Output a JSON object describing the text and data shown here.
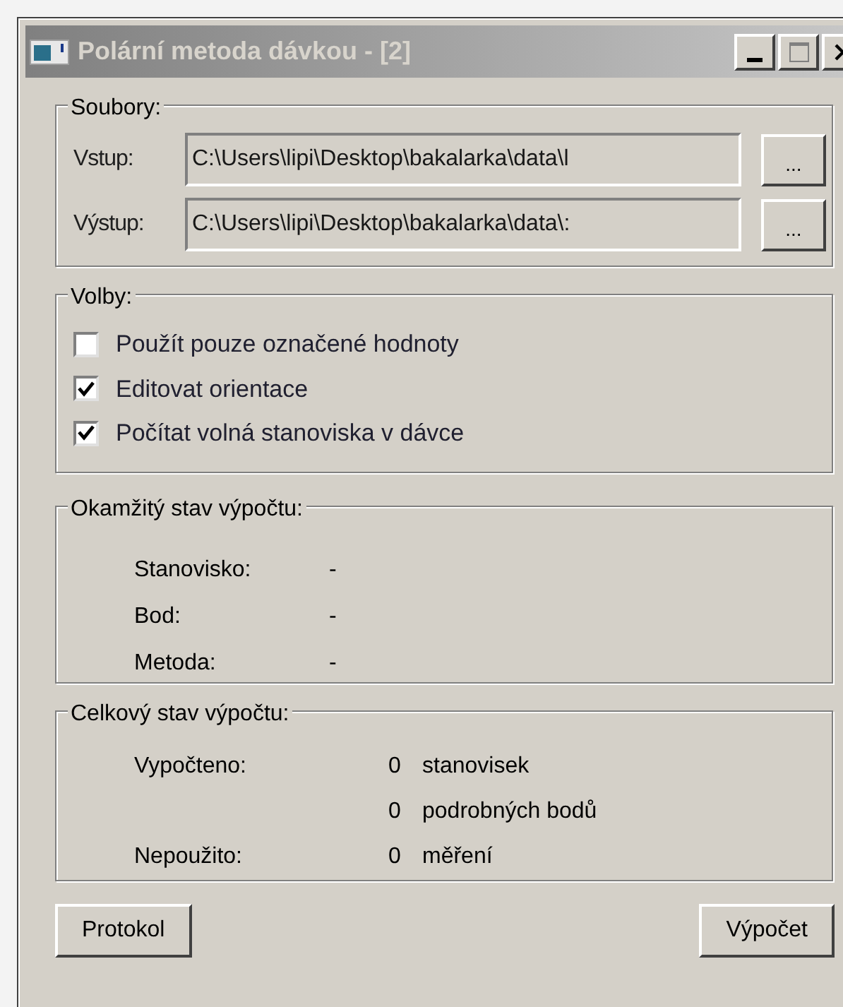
{
  "window": {
    "title": "Polární metoda dávkou - [2]"
  },
  "files": {
    "title": "Soubory:",
    "rows": [
      {
        "label": "Vstup:",
        "value": "C:\\Users\\lipi\\Desktop\\bakalarka\\data\\l",
        "browse": "..."
      },
      {
        "label": "Výstup:",
        "value": "C:\\Users\\lipi\\Desktop\\bakalarka\\data\\:",
        "browse": "..."
      }
    ]
  },
  "options": {
    "title": "Volby:",
    "items": [
      {
        "label": "Použít pouze označené hodnoty",
        "checked": false
      },
      {
        "label": "Editovat orientace",
        "checked": true
      },
      {
        "label": "Počítat volná stanoviska v dávce",
        "checked": true
      }
    ]
  },
  "current_state": {
    "title": "Okamžitý stav výpočtu:",
    "rows": [
      {
        "label": "Stanovisko:",
        "value": "-"
      },
      {
        "label": "Bod:",
        "value": "-"
      },
      {
        "label": "Metoda:",
        "value": "-"
      }
    ]
  },
  "total_state": {
    "title": "Celkový stav výpočtu:",
    "rows": [
      {
        "label": "Vypočteno:",
        "count": "0",
        "unit": "stanovisek"
      },
      {
        "label": "",
        "count": "0",
        "unit": "podrobných bodů"
      },
      {
        "label": "Nepoužito:",
        "count": "0",
        "unit": "měření"
      }
    ]
  },
  "buttons": [
    "Protokol",
    "Výpočet"
  ]
}
